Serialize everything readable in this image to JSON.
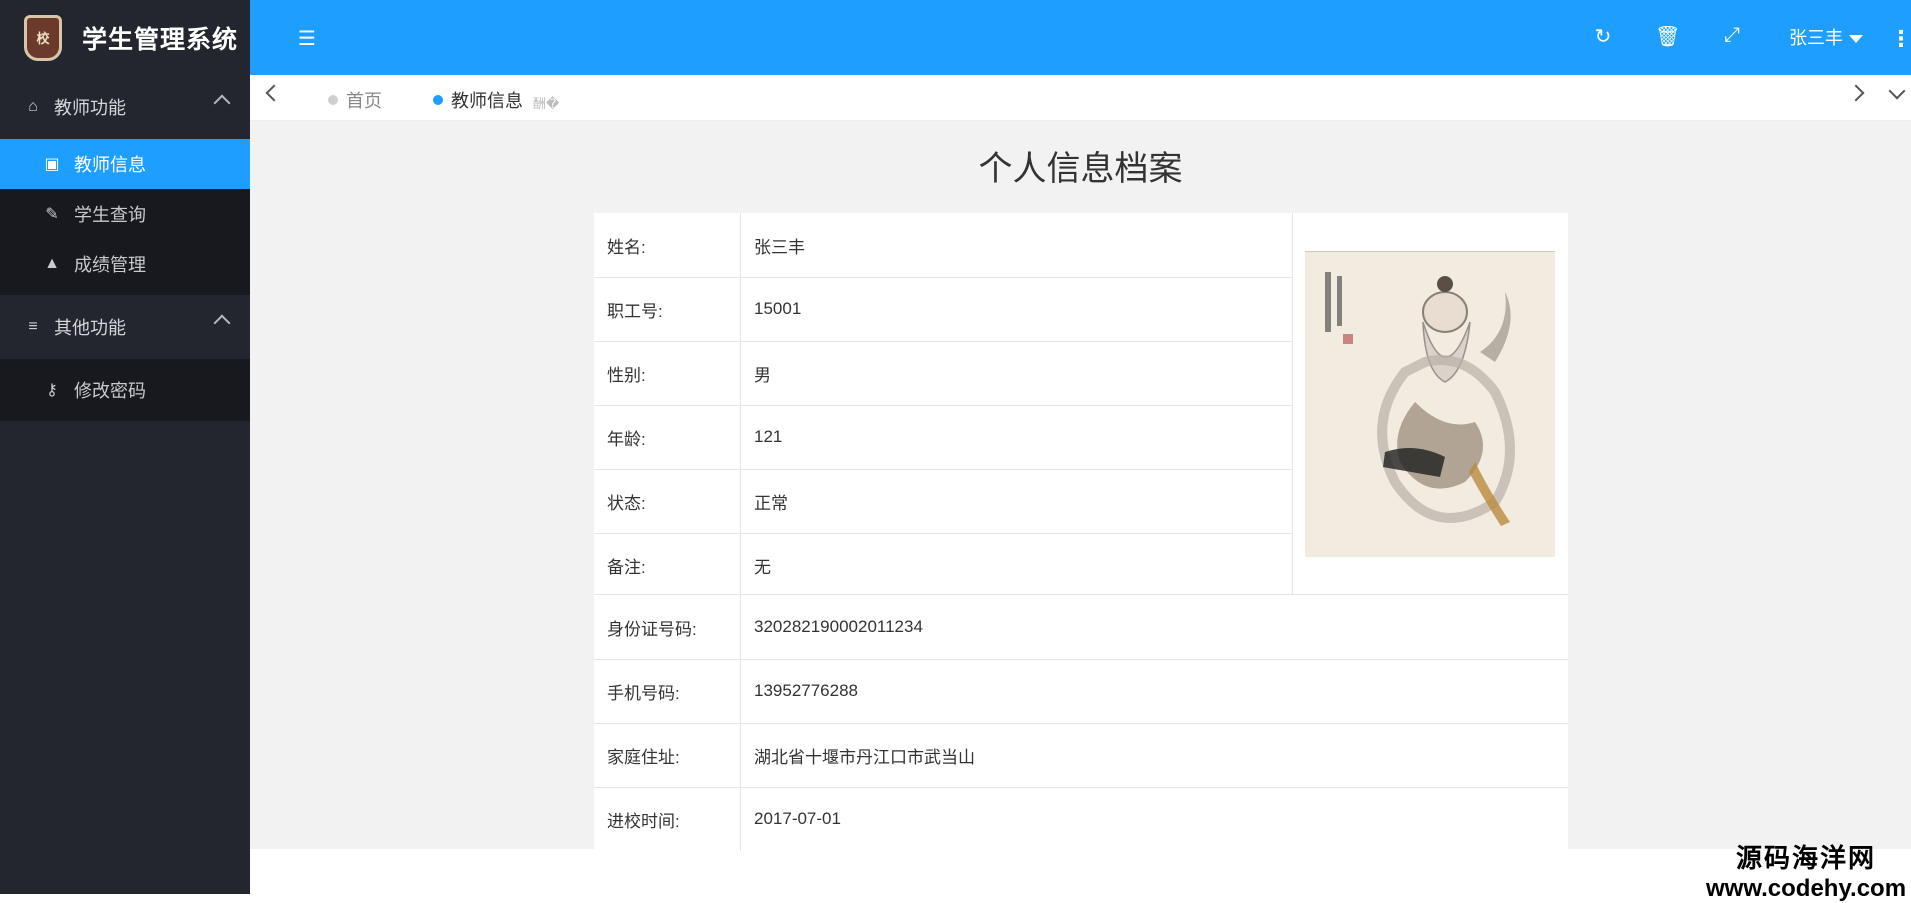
{
  "app": {
    "title": "学生管理系统",
    "logo_text": "校"
  },
  "sidebar": {
    "groups": [
      {
        "label": "教师功能",
        "icon": "home-icon",
        "items": [
          {
            "label": "教师信息",
            "icon": "briefcase-icon",
            "active": true
          },
          {
            "label": "学生查询",
            "icon": "pencil-icon"
          },
          {
            "label": "成绩管理",
            "icon": "graduation-cap-icon"
          }
        ]
      },
      {
        "label": "其他功能",
        "icon": "list-icon",
        "items": [
          {
            "label": "修改密码",
            "icon": "key-icon"
          }
        ]
      }
    ]
  },
  "topbar": {
    "icons": [
      "menu-toggle-icon",
      "refresh-icon",
      "trash-icon",
      "fullscreen-icon",
      "more-vertical-icon"
    ],
    "user": "张三丰",
    "accent": "#1e9fff"
  },
  "tabs": [
    {
      "label": "首页",
      "active": false
    },
    {
      "label": "教师信息",
      "active": true,
      "close": "酬�"
    }
  ],
  "profile": {
    "title": "个人信息档案",
    "fields": [
      {
        "label": "姓名:",
        "value": "张三丰"
      },
      {
        "label": "职工号:",
        "value": "15001"
      },
      {
        "label": "性别:",
        "value": "男"
      },
      {
        "label": "年龄:",
        "value": "121"
      },
      {
        "label": "状态:",
        "value": "正常"
      },
      {
        "label": "备注:",
        "value": "无"
      },
      {
        "label": "身份证号码:",
        "value": "320282190002011234"
      },
      {
        "label": "手机号码:",
        "value": "13952776288"
      },
      {
        "label": "家庭住址:",
        "value": "湖北省十堰市丹江口市武当山"
      },
      {
        "label": "进校时间:",
        "value": "2017-07-01"
      }
    ]
  },
  "watermark": {
    "line1": "源码海洋网",
    "line2": "www.codehy.com"
  }
}
